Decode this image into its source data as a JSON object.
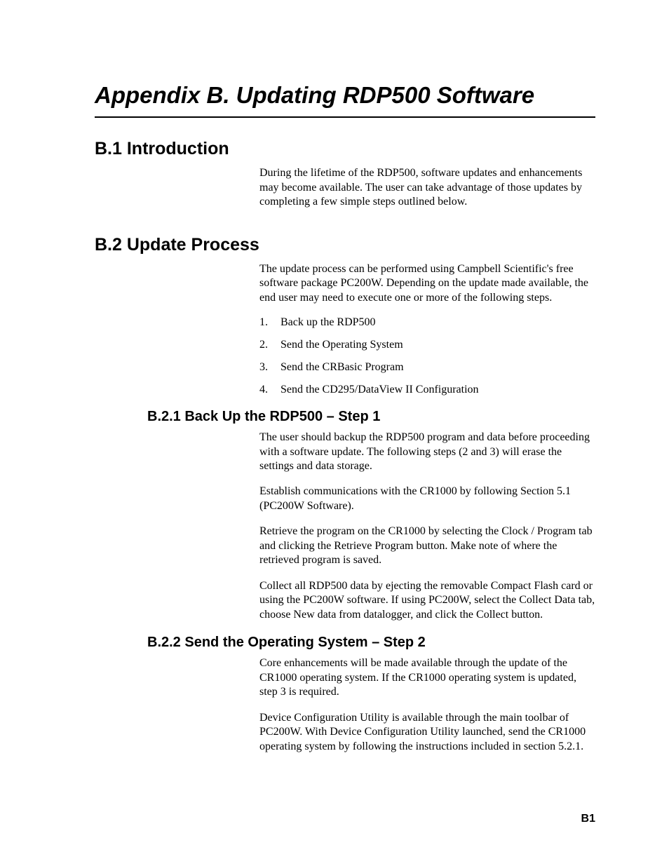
{
  "title": "Appendix B.  Updating RDP500 Software",
  "sections": {
    "b1": {
      "heading": "B.1  Introduction",
      "p1": "During the lifetime of the RDP500, software updates and enhancements may become available. The user can take advantage of those updates by completing a few simple steps outlined below."
    },
    "b2": {
      "heading": "B.2  Update Process",
      "p1": "The update process can be performed using Campbell Scientific's free software package PC200W. Depending on the update made available, the end user may need to execute one or more of the following steps.",
      "list": [
        {
          "n": "1.",
          "t": "Back up the RDP500"
        },
        {
          "n": "2.",
          "t": "Send the Operating System"
        },
        {
          "n": "3.",
          "t": "Send the CRBasic Program"
        },
        {
          "n": "4.",
          "t": "Send the CD295/DataView II Configuration"
        }
      ]
    },
    "b21": {
      "heading": "B.2.1  Back Up the RDP500 – Step 1",
      "p1": "The user should backup the RDP500 program and data before proceeding with a software update. The following steps (2 and 3) will erase the settings and data storage.",
      "p2": "Establish communications with the CR1000 by following Section 5.1 (PC200W Software).",
      "p3": "Retrieve the program on the CR1000 by selecting the Clock / Program tab and clicking the Retrieve Program button. Make note of where the retrieved program is saved.",
      "p4": "Collect all RDP500 data by ejecting the removable Compact Flash card or using the PC200W software. If using PC200W, select the Collect Data tab, choose New data from datalogger, and click the Collect button."
    },
    "b22": {
      "heading": "B.2.2  Send the Operating System – Step 2",
      "p1": "Core enhancements will be made available through the update of the CR1000 operating system. If the CR1000 operating system is updated, step 3 is required.",
      "p2": "Device Configuration Utility is available through the main toolbar of PC200W. With Device Configuration Utility launched, send the CR1000 operating system by following the instructions included in section 5.2.1."
    }
  },
  "page_number": "B1"
}
